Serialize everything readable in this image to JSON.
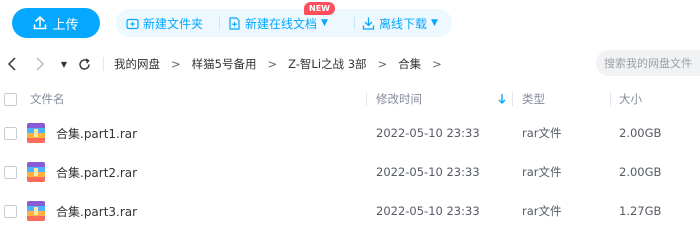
{
  "toolbar": {
    "upload_label": "上传",
    "new_folder_label": "新建文件夹",
    "new_online_doc_label": "新建在线文档",
    "new_badge": "NEW",
    "offline_download_label": "离线下载",
    "accent_color": "#06a7ff",
    "badge_color": "#ff4d5a"
  },
  "nav": {
    "breadcrumbs": [
      "我的网盘",
      "样猫5号备用",
      "Z-智Li之战 3部",
      "合集"
    ],
    "separator": ">",
    "search_placeholder": "搜索我的网盘文件"
  },
  "table": {
    "headers": {
      "name": "文件名",
      "modified": "修改时间",
      "type": "类型",
      "size": "大小"
    },
    "sort_icon": "sort-down-arrow-icon",
    "rows": [
      {
        "name": "合集.part1.rar",
        "modified": "2022-05-10 23:33",
        "type": "rar文件",
        "size": "2.00GB"
      },
      {
        "name": "合集.part2.rar",
        "modified": "2022-05-10 23:33",
        "type": "rar文件",
        "size": "2.00GB"
      },
      {
        "name": "合集.part3.rar",
        "modified": "2022-05-10 23:33",
        "type": "rar文件",
        "size": "1.27GB"
      }
    ]
  }
}
